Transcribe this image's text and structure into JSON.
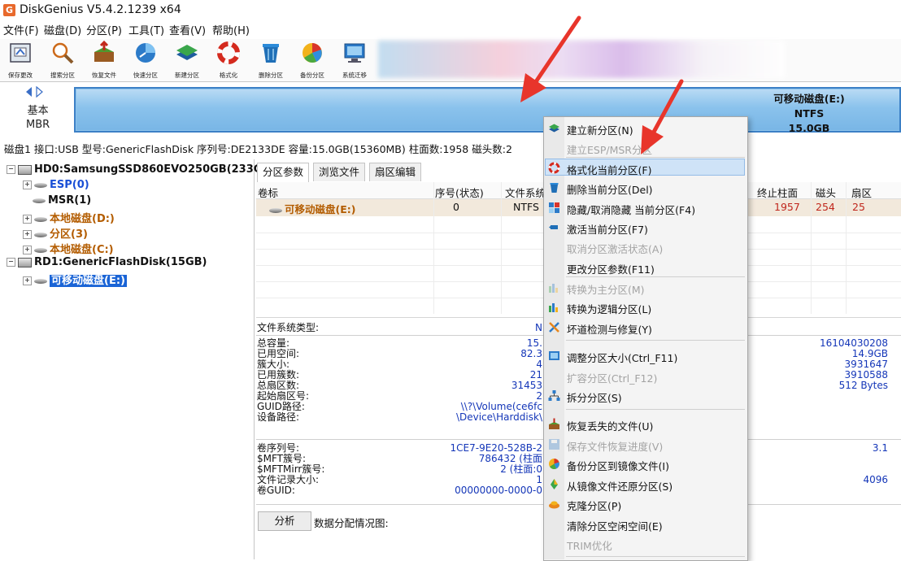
{
  "window": {
    "title": "DiskGenius V5.4.2.1239 x64",
    "icon": "diskgenius-logo-icon"
  },
  "menubar": [
    "文件(F)",
    "磁盘(D)",
    "分区(P)",
    "工具(T)",
    "查看(V)",
    "帮助(H)"
  ],
  "toolbar": [
    {
      "label": "保存更改",
      "icon": "save-changes-icon"
    },
    {
      "label": "搜索分区",
      "icon": "search-icon"
    },
    {
      "label": "恢复文件",
      "icon": "recover-files-icon"
    },
    {
      "label": "快速分区",
      "icon": "quick-partition-icon"
    },
    {
      "label": "新建分区",
      "icon": "new-partition-icon"
    },
    {
      "label": "格式化",
      "icon": "format-icon"
    },
    {
      "label": "删除分区",
      "icon": "delete-partition-icon"
    },
    {
      "label": "备份分区",
      "icon": "backup-partition-icon"
    },
    {
      "label": "系统迁移",
      "icon": "system-migrate-icon"
    }
  ],
  "disk_panel": {
    "type_line1": "基本",
    "type_line2": "MBR",
    "partition_name": "可移动磁盘(E:)",
    "partition_fs": "NTFS",
    "partition_size": "15.0GB"
  },
  "info_line": "磁盘1 接口:USB  型号:GenericFlashDisk  序列号:DE2133DE  容量:15.0GB(15360MB)  柱面数:1958  磁头数:2",
  "tree": [
    {
      "label": "HD0:SamsungSSD860EVO250GB(233GI",
      "kind": "disk",
      "color": "black"
    },
    {
      "label": "ESP(0)",
      "kind": "part",
      "color": "blue"
    },
    {
      "label": "MSR(1)",
      "kind": "part",
      "color": "black"
    },
    {
      "label": "本地磁盘(D:)",
      "kind": "part",
      "color": "orange"
    },
    {
      "label": "分区(3)",
      "kind": "part",
      "color": "orange"
    },
    {
      "label": "本地磁盘(C:)",
      "kind": "part",
      "color": "orange"
    },
    {
      "label": "RD1:GenericFlashDisk(15GB)",
      "kind": "disk",
      "color": "black"
    },
    {
      "label": "可移动磁盘(E:)",
      "kind": "part",
      "color": "selected"
    }
  ],
  "tabs": [
    "分区参数",
    "浏览文件",
    "扇区编辑"
  ],
  "grid": {
    "headers": [
      "卷标",
      "序号(状态)",
      "文件系统",
      "终止柱面",
      "磁头",
      "扇区"
    ],
    "row": {
      "label": "可移动磁盘(E:)",
      "index": "0",
      "fs": "NTFS",
      "end_cyl": "1957",
      "head": "254",
      "sector": "25"
    }
  },
  "details": {
    "fs_type_label": "文件系统类型:",
    "fs_type_value": "N",
    "labels_a": [
      "总容量:",
      "已用空间:",
      "簇大小:",
      "已用簇数:",
      "总扇区数:",
      "起始扇区号:",
      "GUID路径:",
      "设备路径:"
    ],
    "values_a": [
      "15.",
      "82.3",
      "4",
      "21",
      "31453",
      "2",
      "\\\\?\\Volume(ce6fc",
      "\\Device\\Harddisk\\"
    ],
    "right_a": [
      "16104030208",
      "14.9GB",
      "3931647",
      "3910588",
      "512 Bytes"
    ],
    "labels_b": [
      "卷序列号:",
      "$MFT簇号:",
      "$MFTMirr簇号:",
      "文件记录大小:",
      "卷GUID:"
    ],
    "values_b": [
      "1CE7-9E20-528B-2",
      "786432 (柱面",
      "2 (柱面:0",
      "1",
      "00000000-0000-0"
    ],
    "right_b1": "3.1",
    "right_b2": "4096",
    "analyze_button": "分析",
    "analyze_label": "数据分配情况图:"
  },
  "context_menu": [
    {
      "label": "建立新分区(N)",
      "enabled": true,
      "icon": "new-partition-icon"
    },
    {
      "label": "建立ESP/MSR分区",
      "enabled": false,
      "icon": ""
    },
    {
      "label": "格式化当前分区(F)",
      "enabled": true,
      "icon": "format-icon",
      "highlight": true
    },
    {
      "label": "删除当前分区(Del)",
      "enabled": true,
      "icon": "delete-partition-icon"
    },
    {
      "label": "隐藏/取消隐藏 当前分区(F4)",
      "enabled": true,
      "icon": "hide-partition-icon"
    },
    {
      "label": "激活当前分区(F7)",
      "enabled": true,
      "icon": "activate-partition-icon"
    },
    {
      "label": "取消分区激活状态(A)",
      "enabled": false,
      "icon": ""
    },
    {
      "label": "更改分区参数(F11)",
      "enabled": true,
      "icon": ""
    },
    {
      "label": "转换为主分区(M)",
      "enabled": false,
      "icon": "convert-primary-icon"
    },
    {
      "label": "转换为逻辑分区(L)",
      "enabled": true,
      "icon": "convert-logical-icon"
    },
    {
      "label": "坏道检测与修复(Y)",
      "enabled": true,
      "icon": "bad-sector-repair-icon"
    },
    {
      "label": "调整分区大小(Ctrl_F11)",
      "enabled": true,
      "icon": "resize-partition-icon"
    },
    {
      "label": "扩容分区(Ctrl_F12)",
      "enabled": false,
      "icon": ""
    },
    {
      "label": "拆分分区(S)",
      "enabled": true,
      "icon": "split-partition-icon"
    },
    {
      "label": "恢复丢失的文件(U)",
      "enabled": true,
      "icon": "recover-files-icon"
    },
    {
      "label": "保存文件恢复进度(V)",
      "enabled": false,
      "icon": "save-progress-icon"
    },
    {
      "label": "备份分区到镜像文件(I)",
      "enabled": true,
      "icon": "backup-partition-icon"
    },
    {
      "label": "从镜像文件还原分区(S)",
      "enabled": true,
      "icon": "restore-partition-icon"
    },
    {
      "label": "克隆分区(P)",
      "enabled": true,
      "icon": "clone-partition-icon"
    },
    {
      "label": "清除分区空闲空间(E)",
      "enabled": true,
      "icon": ""
    },
    {
      "label": "TRIM优化",
      "enabled": false,
      "icon": ""
    }
  ],
  "colors": {
    "accent": "#1a64d6",
    "partition_bar": "#8ec4ec",
    "arrow": "#e8352b",
    "context_highlight": "#cfe3f7"
  }
}
